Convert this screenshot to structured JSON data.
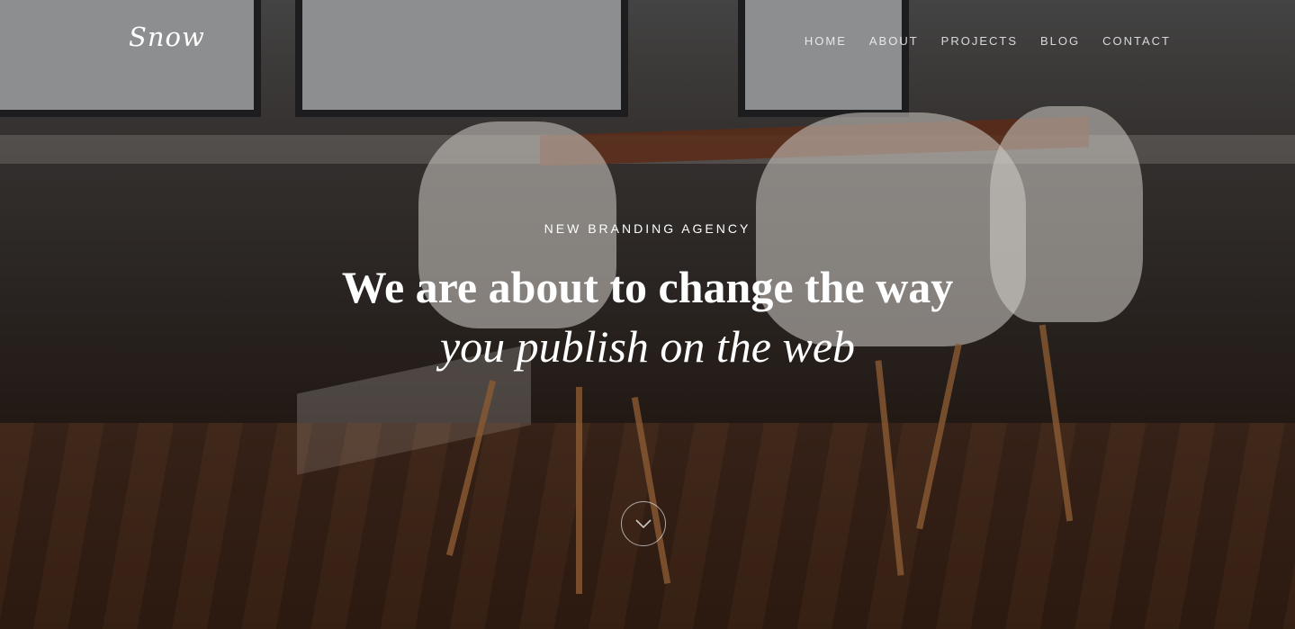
{
  "brand": {
    "logo_text": "Snow"
  },
  "nav": {
    "items": [
      {
        "label": "HOME"
      },
      {
        "label": "ABOUT"
      },
      {
        "label": "PROJECTS"
      },
      {
        "label": "BLOG"
      },
      {
        "label": "CONTACT"
      }
    ]
  },
  "hero": {
    "eyebrow": "NEW BRANDING AGENCY",
    "headline": "We are about to change the way",
    "subline": "you publish on the web",
    "scroll_icon": "chevron-down-icon"
  },
  "colors": {
    "text": "#ffffff",
    "overlay": "#1a1512"
  }
}
